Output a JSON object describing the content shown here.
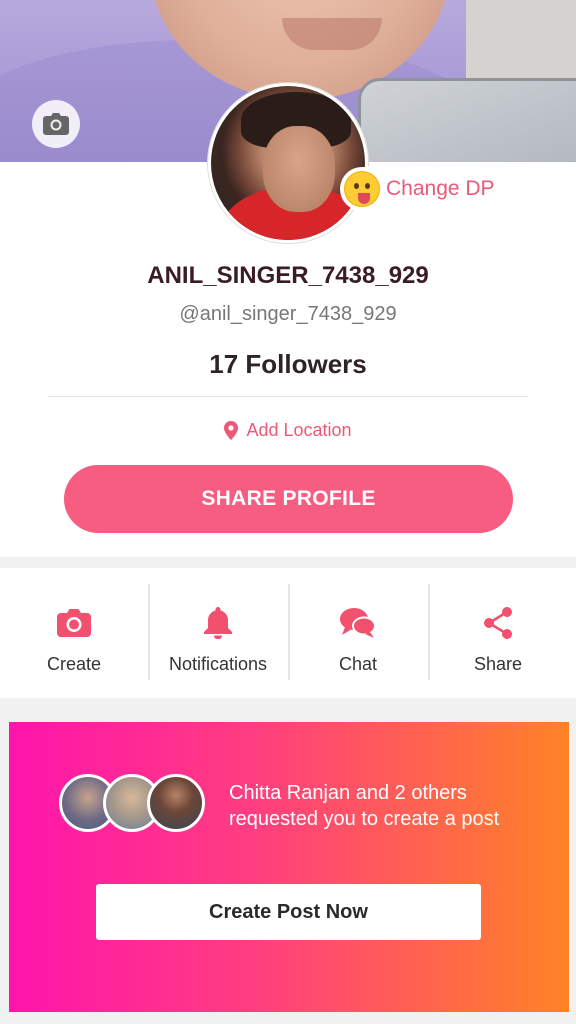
{
  "profile": {
    "change_dp_label": "Change DP",
    "username": "ANIL_SINGER_7438_929",
    "handle": "@anil_singer_7438_929",
    "followers": "17 Followers",
    "location_label": "Add Location",
    "share_profile_label": "SHARE PROFILE"
  },
  "actions": [
    {
      "label": "Create",
      "icon": "camera-icon"
    },
    {
      "label": "Notifications",
      "icon": "bell-icon"
    },
    {
      "label": "Chat",
      "icon": "chat-bubbles-icon"
    },
    {
      "label": "Share",
      "icon": "share-icon"
    }
  ],
  "request": {
    "text": "Chitta Ranjan and 2 others requested you to create a post",
    "button_label": "Create Post Now"
  },
  "colors": {
    "accent": "#f75d81",
    "accent_text": "#ee5877",
    "gradient_start": "#ff14ac",
    "gradient_end": "#ff8326"
  }
}
